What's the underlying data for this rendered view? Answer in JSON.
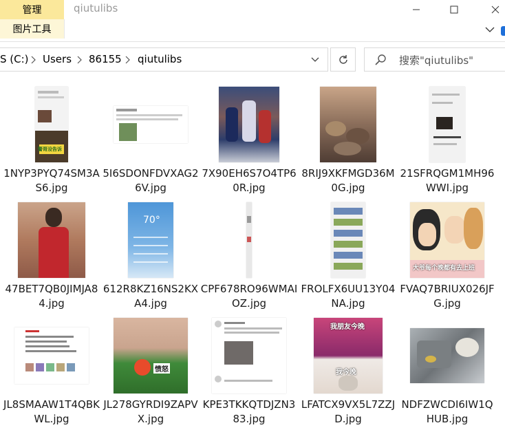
{
  "ribbon": {
    "manage_tab": "管理",
    "picture_tools_tab": "图片工具",
    "window_title": "qiutulibs"
  },
  "address_bar": {
    "crumbs": [
      "S (C:)",
      "Users",
      "86155",
      "qiutulibs"
    ]
  },
  "search": {
    "placeholder": "搜索\"qiutulibs\""
  },
  "files": [
    {
      "name": "1NYP3PYQ74SM3AS6.jpg",
      "thumb": "chat-screenshot",
      "sticker": "警哥没告诉"
    },
    {
      "name": "5I6SDONFDVXAG26V.jpg",
      "thumb": "social-post"
    },
    {
      "name": "7X90EH6S7O4TP60R.jpg",
      "thumb": "basketball-poster"
    },
    {
      "name": "8RIJ9XKFMGD36M0G.jpg",
      "thumb": "cats-photo"
    },
    {
      "name": "21SFRQGM1MH96WWI.jpg",
      "thumb": "phone-chat"
    },
    {
      "name": "47BET7QB0JIMJA84.jpg",
      "thumb": "basketball-player"
    },
    {
      "name": "612R8KZ16NS2KXA4.jpg",
      "thumb": "weather-app",
      "temp": "70°"
    },
    {
      "name": "CPF678RO96WMAIOZ.jpg",
      "thumb": "long-strip"
    },
    {
      "name": "FROLFX6UU13Y04NA.jpg",
      "thumb": "phone-list"
    },
    {
      "name": "FVAQ7BRIUX026JFG.jpg",
      "thumb": "cartoon",
      "sticker": "大爷每个晚都有去上班"
    },
    {
      "name": "JL8SMAAW1T4QBKWL.jpg",
      "thumb": "text-post"
    },
    {
      "name": "JL278GYRDI9ZAPVX.jpg",
      "thumb": "green-beans",
      "sticker": "愤怒"
    },
    {
      "name": "KPE3TKKQTDJZN383.jpg",
      "thumb": "feed-post"
    },
    {
      "name": "LFATCX9VX5L7ZZJD.jpg",
      "thumb": "concert-meme",
      "caption_top": "我朋友今晚",
      "caption_bottom": "我今晚"
    },
    {
      "name": "NDFZWCDI6IW1QHUB.jpg",
      "thumb": "kitchen-sink"
    }
  ],
  "colors": {
    "manage_tab_bg": "#fbe89b",
    "picture_tools_bg": "#fdf6d7"
  }
}
